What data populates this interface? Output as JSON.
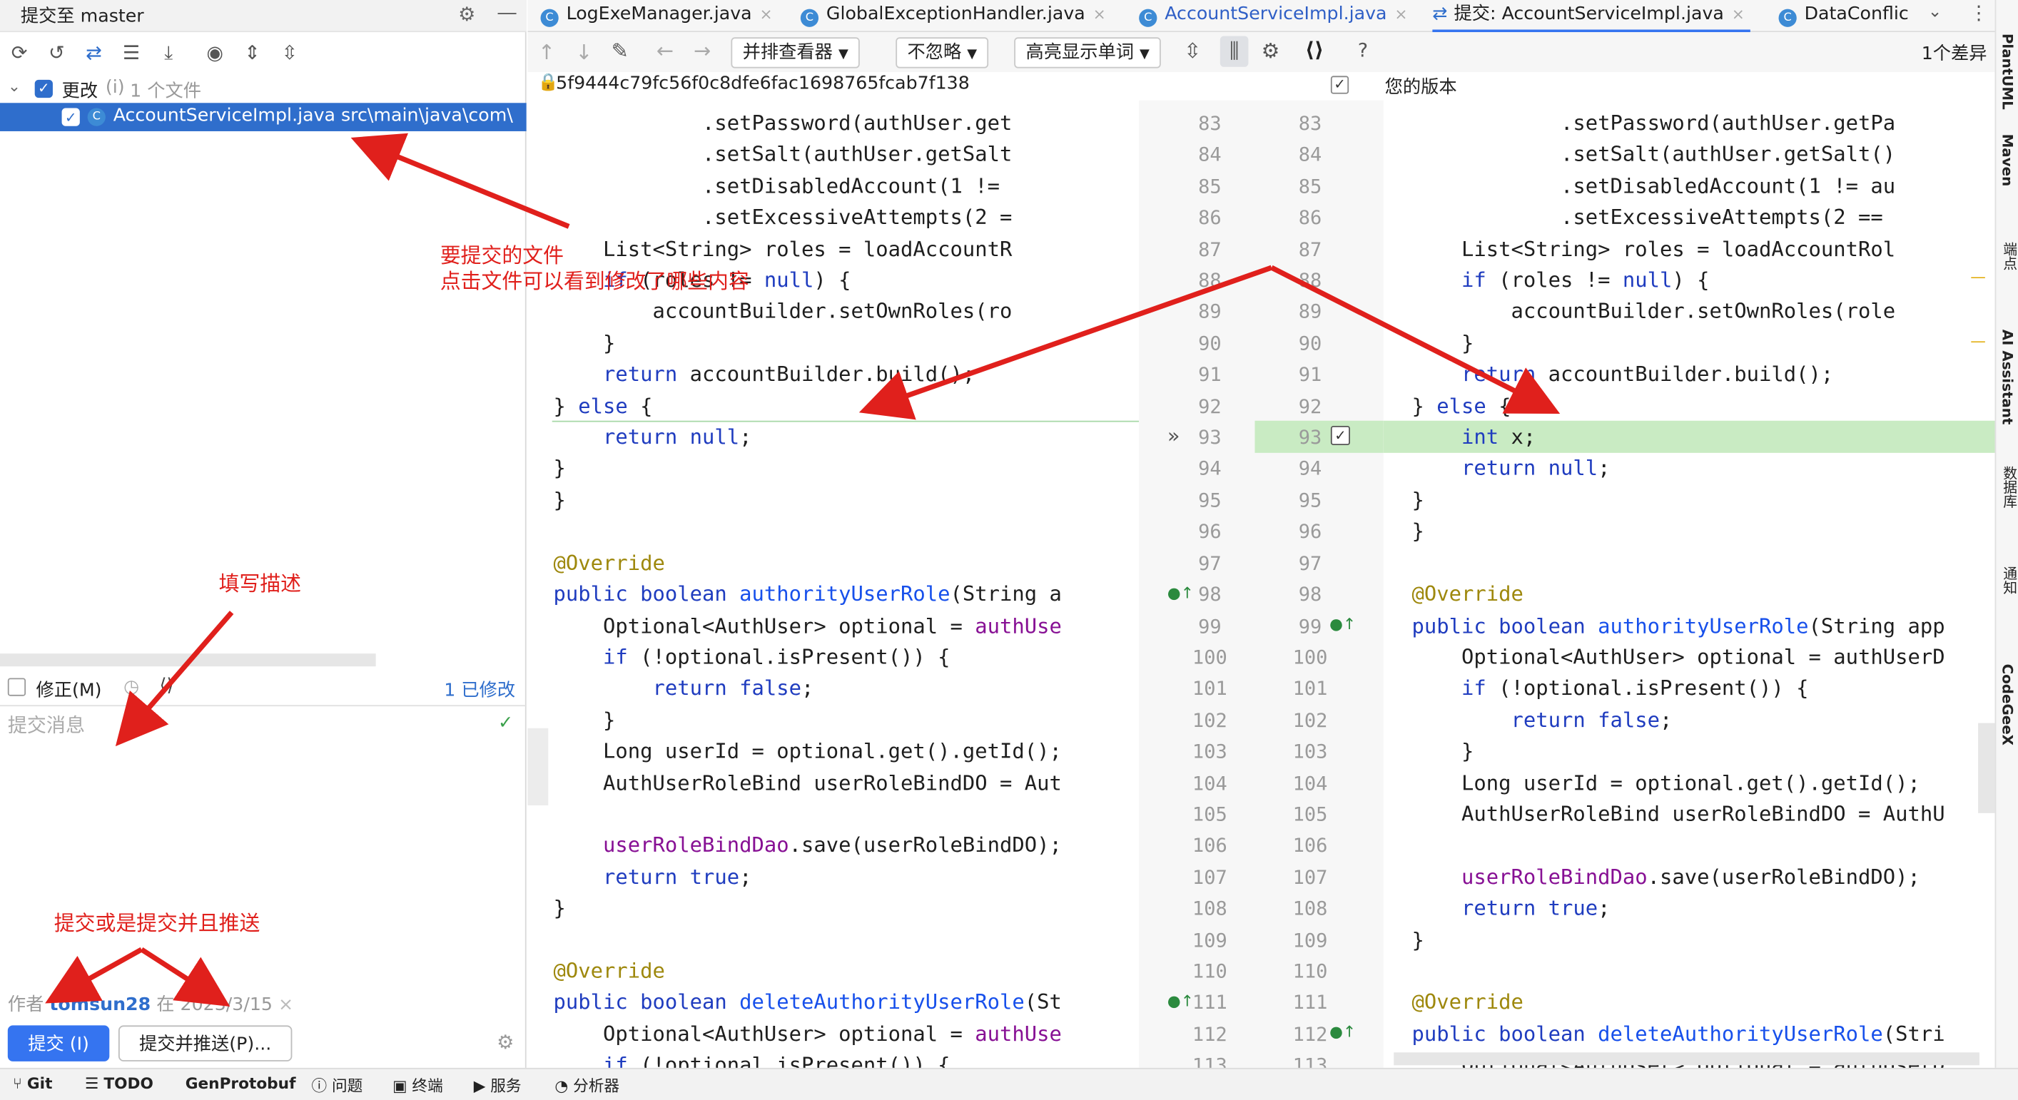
{
  "left_panel": {
    "title": "提交至 master",
    "change_group": "更改",
    "change_group_hint": "(i)",
    "change_count": "1 个文件",
    "file_item": "AccountServiceImpl.java src\\main\\java\\com\\",
    "amend_label": "修正(M)",
    "modified": "1 已修改",
    "commit_placeholder": "提交消息",
    "author_prefix": "作者",
    "author": "tomsun28",
    "author_date_sep": "在",
    "date": "2023/3/15",
    "commit_btn": "提交 (I)",
    "commit_push_btn": "提交并推送(P)..."
  },
  "tabs": [
    "LogExeManager.java",
    "GlobalExceptionHandler.java",
    "AccountServiceImpl.java",
    "提交: AccountServiceImpl.java",
    "DataConflic"
  ],
  "diff_toolbar": {
    "viewer": "并排查看器",
    "ignore": "不忽略",
    "highlight": "高亮显示单词",
    "diff_count": "1个差异",
    "help": "?"
  },
  "diff_header": {
    "commit_hash": "5f9444c79fc56f0c8dfe6fac1698765fcab7f138",
    "right_title": "您的版本"
  },
  "left_lines": [
    "            .setPassword(authUser.get",
    "            .setSalt(authUser.getSalt",
    "            .setDisabledAccount(1 !=",
    "            .setExcessiveAttempts(2 =",
    "    List<String> roles = loadAccountR",
    "    if (roles != null) {",
    "        accountBuilder.setOwnRoles(ro",
    "    }",
    "    return accountBuilder.build();",
    "} else {",
    "    return null;",
    "}",
    "}",
    "",
    "@Override",
    "public boolean authorityUserRole(String a",
    "    Optional<AuthUser> optional = authUse",
    "    if (!optional.isPresent()) {",
    "        return false;",
    "    }",
    "    Long userId = optional.get().getId();",
    "    AuthUserRoleBind userRoleBindDO = Aut",
    "",
    "    userRoleBindDao.save(userRoleBindDO);",
    "    return true;",
    "}",
    "",
    "@Override",
    "public boolean deleteAuthorityUserRole(St",
    "    Optional<AuthUser> optional = authUse",
    "    if (!optional.isPresent()) {"
  ],
  "right_lines": [
    "            .setPassword(authUser.getPa",
    "            .setSalt(authUser.getSalt()",
    "            .setDisabledAccount(1 != au",
    "            .setExcessiveAttempts(2 ==",
    "    List<String> roles = loadAccountRol",
    "    if (roles != null) {",
    "        accountBuilder.setOwnRoles(role",
    "    }",
    "    return accountBuilder.build();",
    "} else {",
    "    int x;",
    "    return null;",
    "}",
    "}",
    "",
    "@Override",
    "public boolean authorityUserRole(String app",
    "    Optional<AuthUser> optional = authUserD",
    "    if (!optional.isPresent()) {",
    "        return false;",
    "    }",
    "    Long userId = optional.get().getId();",
    "    AuthUserRoleBind userRoleBindDO = AuthU",
    "",
    "    userRoleBindDao.save(userRoleBindDO);",
    "    return true;",
    "}",
    "",
    "@Override",
    "public boolean deleteAuthorityUserRole(Stri",
    "    Optional<AuthUser> optional = authUserD"
  ],
  "line_numbers_left": [
    "83",
    "84",
    "85",
    "86",
    "87",
    "88",
    "89",
    "90",
    "91",
    "92",
    "93",
    "94",
    "95",
    "96",
    "97",
    "98",
    "99",
    "100",
    "101",
    "102",
    "103",
    "104",
    "105",
    "106",
    "107",
    "108",
    "109",
    "110",
    "111",
    "112",
    "113"
  ],
  "line_numbers_right": [
    "83",
    "84",
    "85",
    "86",
    "87",
    "88",
    "89",
    "90",
    "91",
    "92",
    "93",
    "94",
    "95",
    "96",
    "97",
    "98",
    "99",
    "100",
    "101",
    "102",
    "103",
    "104",
    "105",
    "106",
    "107",
    "108",
    "109",
    "110",
    "111",
    "112",
    "113"
  ],
  "annotations": {
    "files": "要提交的文件",
    "files2": "点击文件可以看到修改了哪些内容",
    "desc": "填写描述",
    "commit": "提交或是提交并且推送"
  },
  "right_tools": [
    "PlantUML",
    "Maven",
    "端点",
    "AI Assistant",
    "数据库",
    "通知",
    "CodeGeeX"
  ],
  "status_bar": [
    "Git",
    "TODO",
    "GenProtobuf",
    "问题",
    "终端",
    "服务",
    "分析器"
  ]
}
